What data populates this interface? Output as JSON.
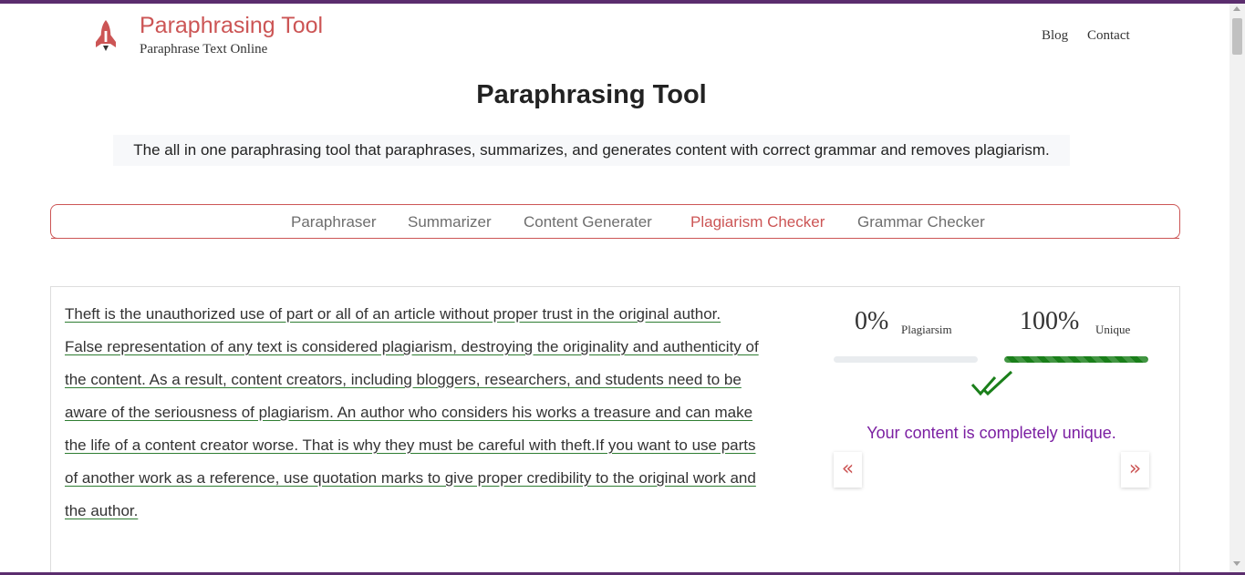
{
  "header": {
    "brand_title": "Paraphrasing Tool",
    "brand_subtitle": "Paraphrase Text Online",
    "nav": [
      "Blog",
      "Contact"
    ],
    "logo_icon": "rocket-icon",
    "accent_color": "#cc5555",
    "top_bar_color": "#5b2d6e"
  },
  "main": {
    "title": "Paraphrasing Tool",
    "tagline": "The all in one paraphrasing tool that paraphrases, summarizes, and generates content with correct grammar and removes plagiarism."
  },
  "tabs": {
    "items": [
      "Paraphraser",
      "Summarizer",
      "Content Generater",
      "Plagiarism Checker",
      "Grammar Checker"
    ],
    "active": "Plagiarism Checker"
  },
  "content": {
    "text_lines": [
      "Theft is the unauthorized use of part or all of an article without proper trust in the original author.",
      "False representation of any text is considered plagiarism, destroying the originality and authenticity of",
      "the content. As a result, content creators, including bloggers, researchers, and students need to be",
      "aware of the seriousness of plagiarism. An author who considers his works a treasure and can make",
      "the life of a content creator worse. That is why they must be careful with theft.If you want to use parts",
      "of another work as a reference, use quotation marks to give proper credibility to the original work and",
      "the author."
    ]
  },
  "results": {
    "plagiarism_value": "0%",
    "plagiarism_label": "Plagiarsim",
    "plagiarism_fraction": 0,
    "unique_value": "100%",
    "unique_label": "Unique",
    "unique_fraction": 1,
    "message": "Your content is completely unique.",
    "success_color": "#1a7f1a",
    "message_color": "#7b1fa2",
    "check_icon": "double-check-icon",
    "prev_icon": "chevron-double-left-icon",
    "next_icon": "chevron-double-right-icon"
  }
}
